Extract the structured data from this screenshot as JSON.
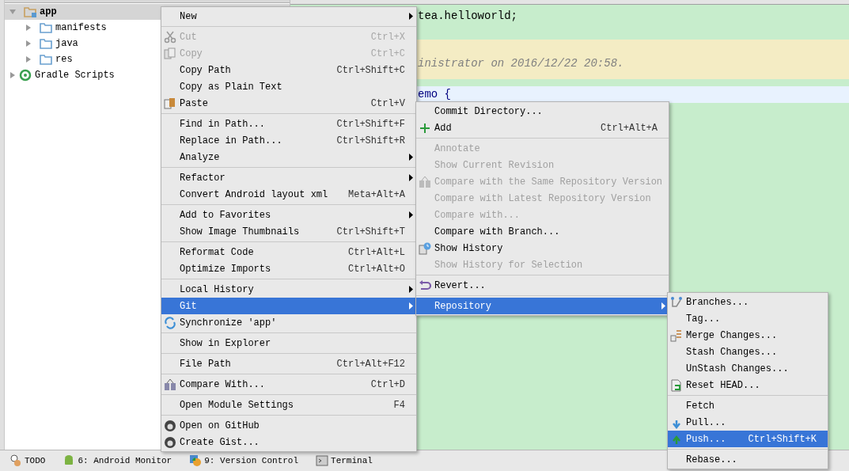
{
  "project_tree": [
    {
      "label": "app",
      "expanded": true,
      "selected": true,
      "children": [
        {
          "label": "manifests",
          "expanded": false,
          "selected": false
        },
        {
          "label": "java",
          "expanded": false,
          "selected": false
        },
        {
          "label": "res",
          "expanded": false,
          "selected": false
        }
      ]
    },
    {
      "label": "Gradle Scripts",
      "expanded": false,
      "selected": false
    }
  ],
  "editor": {
    "package_line": "tea.helloworld;",
    "comment_line": "inistrator on 2016/12/22 20:58.",
    "class_line": "emo {"
  },
  "context_menu": {
    "sections": [
      [
        {
          "label": "New",
          "submenu": true,
          "disabled": false,
          "selected": false
        }
      ],
      [
        {
          "label": "Cut",
          "shortcut": "Ctrl+X",
          "disabled": true,
          "selected": false
        },
        {
          "label": "Copy",
          "shortcut": "Ctrl+C",
          "disabled": true,
          "selected": false
        },
        {
          "label": "Copy Path",
          "shortcut": "Ctrl+Shift+C",
          "disabled": false,
          "selected": false
        },
        {
          "label": "Copy as Plain Text",
          "disabled": false,
          "selected": false
        },
        {
          "label": "Paste",
          "shortcut": "Ctrl+V",
          "disabled": false,
          "selected": false
        }
      ],
      [
        {
          "label": "Find in Path...",
          "shortcut": "Ctrl+Shift+F",
          "disabled": false,
          "selected": false
        },
        {
          "label": "Replace in Path...",
          "shortcut": "Ctrl+Shift+R",
          "disabled": false,
          "selected": false
        },
        {
          "label": "Analyze",
          "submenu": true,
          "disabled": false,
          "selected": false
        }
      ],
      [
        {
          "label": "Refactor",
          "submenu": true,
          "disabled": false,
          "selected": false
        },
        {
          "label": "Convert Android layout xml",
          "shortcut": "Meta+Alt+A",
          "disabled": false,
          "selected": false
        }
      ],
      [
        {
          "label": "Add to Favorites",
          "submenu": true,
          "disabled": false,
          "selected": false
        },
        {
          "label": "Show Image Thumbnails",
          "shortcut": "Ctrl+Shift+T",
          "disabled": false,
          "selected": false
        }
      ],
      [
        {
          "label": "Reformat Code",
          "shortcut": "Ctrl+Alt+L",
          "disabled": false,
          "selected": false
        },
        {
          "label": "Optimize Imports",
          "shortcut": "Ctrl+Alt+O",
          "disabled": false,
          "selected": false
        }
      ],
      [
        {
          "label": "Local History",
          "submenu": true,
          "disabled": false,
          "selected": false
        },
        {
          "label": "Git",
          "submenu": true,
          "disabled": false,
          "selected": true
        },
        {
          "label": "Synchronize 'app'",
          "disabled": false,
          "selected": false
        }
      ],
      [
        {
          "label": "Show in Explorer",
          "disabled": false,
          "selected": false
        }
      ],
      [
        {
          "label": "File Path",
          "shortcut": "Ctrl+Alt+F12",
          "disabled": false,
          "selected": false
        }
      ],
      [
        {
          "label": "Compare With...",
          "shortcut": "Ctrl+D",
          "disabled": false,
          "selected": false
        }
      ],
      [
        {
          "label": "Open Module Settings",
          "shortcut": "F4",
          "disabled": false,
          "selected": false
        }
      ],
      [
        {
          "label": "Open on GitHub",
          "disabled": false,
          "selected": false
        },
        {
          "label": "Create Gist...",
          "disabled": false,
          "selected": false
        }
      ]
    ]
  },
  "git_menu": {
    "sections": [
      [
        {
          "label": "Commit Directory...",
          "disabled": false,
          "selected": false
        },
        {
          "label": "Add",
          "shortcut": "Ctrl+Alt+A",
          "disabled": false,
          "selected": false
        }
      ],
      [
        {
          "label": "Annotate",
          "disabled": true,
          "selected": false
        },
        {
          "label": "Show Current Revision",
          "disabled": true,
          "selected": false
        },
        {
          "label": "Compare with the Same Repository Version",
          "disabled": true,
          "selected": false
        },
        {
          "label": "Compare with Latest Repository Version",
          "disabled": true,
          "selected": false
        },
        {
          "label": "Compare with...",
          "disabled": true,
          "selected": false
        },
        {
          "label": "Compare with Branch...",
          "disabled": false,
          "selected": false
        },
        {
          "label": "Show History",
          "disabled": false,
          "selected": false
        },
        {
          "label": "Show History for Selection",
          "disabled": true,
          "selected": false
        }
      ],
      [
        {
          "label": "Revert...",
          "disabled": false,
          "selected": false
        }
      ],
      [
        {
          "label": "Repository",
          "submenu": true,
          "disabled": false,
          "selected": true
        }
      ]
    ]
  },
  "repository_menu": {
    "sections": [
      [
        {
          "label": "Branches...",
          "disabled": false,
          "selected": false
        },
        {
          "label": "Tag...",
          "disabled": false,
          "selected": false
        },
        {
          "label": "Merge Changes...",
          "disabled": false,
          "selected": false
        },
        {
          "label": "Stash Changes...",
          "disabled": false,
          "selected": false
        },
        {
          "label": "UnStash Changes...",
          "disabled": false,
          "selected": false
        },
        {
          "label": "Reset HEAD...",
          "disabled": false,
          "selected": false
        }
      ],
      [
        {
          "label": "Fetch",
          "disabled": false,
          "selected": false
        },
        {
          "label": "Pull...",
          "disabled": false,
          "selected": false
        },
        {
          "label": "Push...",
          "shortcut": "Ctrl+Shift+K",
          "disabled": false,
          "selected": true
        }
      ],
      [
        {
          "label": "Rebase...",
          "disabled": false,
          "selected": false
        }
      ]
    ]
  },
  "tool_windows": [
    {
      "label": "TODO"
    },
    {
      "label": "6: Android Monitor"
    },
    {
      "label": "9: Version Control"
    },
    {
      "label": "Terminal"
    }
  ]
}
